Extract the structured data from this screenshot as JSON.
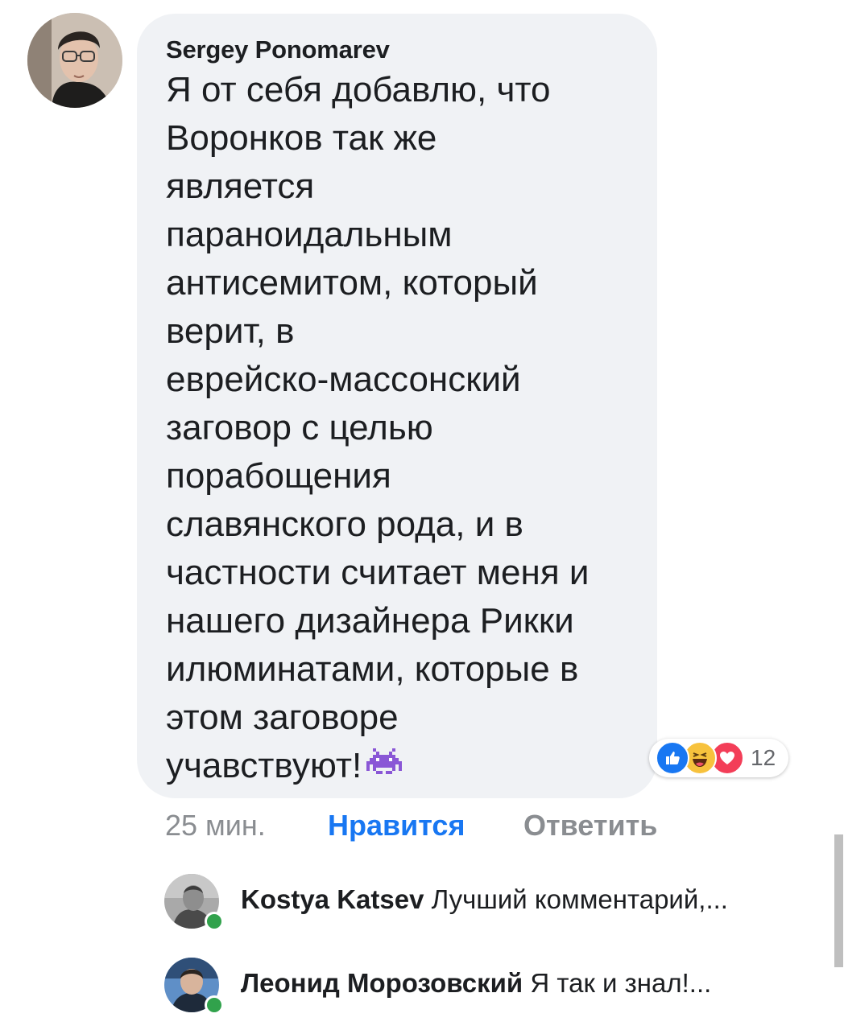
{
  "comment": {
    "author": "Sergey Ponomarev",
    "lines": [
      "Я от себя добавлю, что",
      "Воронков так же",
      "является",
      "параноидальным",
      "антисемитом, который",
      "верит, в",
      "еврейско-массонский",
      "заговор с целью",
      "порабощения",
      "славянского рода, и в",
      "частности считает меня и",
      "нашего дизайнера Рикки",
      "илюминатами, которые в",
      "этом заговоре",
      "учавствуют!"
    ],
    "emoji": "alien-monster-icon",
    "reactions": {
      "icons": [
        "like-icon",
        "haha-icon",
        "love-icon"
      ],
      "count": "12"
    },
    "time": "25 мин.",
    "like_label": "Нравится",
    "reply_label": "Ответить"
  },
  "replies": [
    {
      "name": "Kostya Katsev",
      "text": "Лучший комментарий,..."
    },
    {
      "name": "Леонид Морозовский",
      "text": "Я так и знал!..."
    }
  ],
  "colors": {
    "bubble": "#f0f2f5",
    "link_blue": "#1877f2",
    "muted": "#8a8d91",
    "online": "#31a24c"
  }
}
